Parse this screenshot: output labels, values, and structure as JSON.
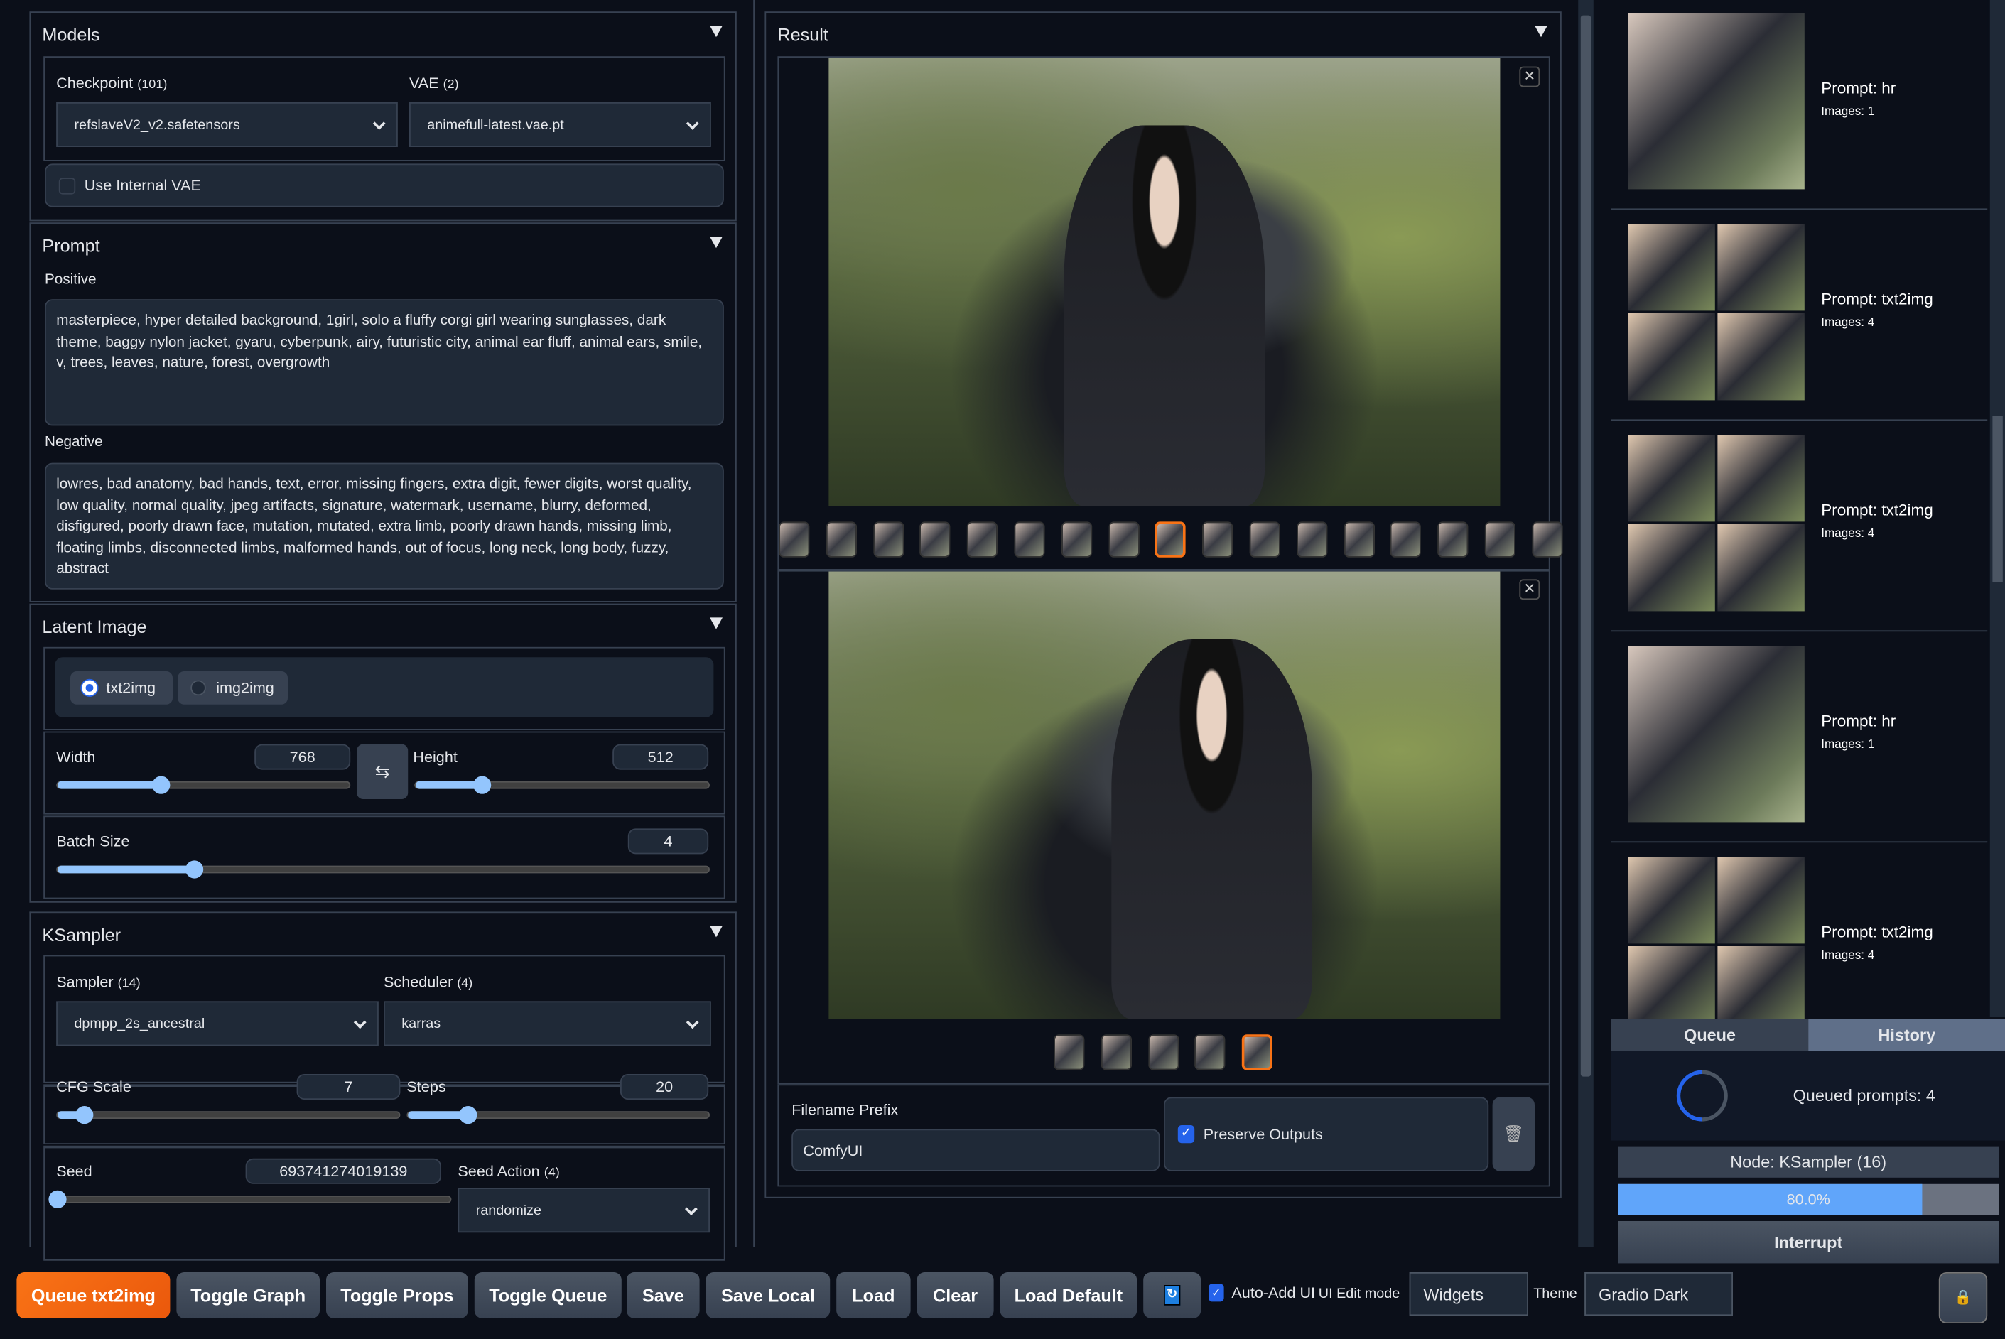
{
  "models": {
    "title": "Models",
    "checkpoint_label": "Checkpoint",
    "checkpoint_count": "(101)",
    "checkpoint_value": "refslaveV2_v2.safetensors",
    "vae_label": "VAE",
    "vae_count": "(2)",
    "vae_value": "animefull-latest.vae.pt",
    "use_internal_vae": "Use Internal VAE",
    "use_internal_vae_checked": false
  },
  "prompt": {
    "title": "Prompt",
    "positive_label": "Positive",
    "positive": "masterpiece, hyper detailed background, 1girl, solo a fluffy corgi girl wearing sunglasses, dark theme, baggy nylon jacket, gyaru, cyberpunk, airy, futuristic city, animal ear fluff, animal ears, smile, v, trees, leaves, nature, forest, overgrowth",
    "negative_label": "Negative",
    "negative": "lowres, bad anatomy, bad hands, text, error, missing fingers, extra digit, fewer digits, worst quality, low quality, normal quality, jpeg artifacts, signature, watermark, username, blurry, deformed, disfigured, poorly drawn face, mutation, mutated, extra limb, poorly drawn hands, missing limb, floating limbs, disconnected limbs, malformed hands, out of focus, long neck, long body, fuzzy, abstract"
  },
  "latent": {
    "title": "Latent Image",
    "mode_txt2img": "txt2img",
    "mode_img2img": "img2img",
    "selected_mode": "txt2img",
    "width_label": "Width",
    "width": "768",
    "width_fraction": 0.355,
    "height_label": "Height",
    "height": "512",
    "height_fraction": 0.226,
    "swap_icon": "swap-arrows-icon",
    "batch_label": "Batch Size",
    "batch": "4",
    "batch_fraction": 0.21
  },
  "ksampler": {
    "title": "KSampler",
    "sampler_label": "Sampler",
    "sampler_count": "(14)",
    "sampler_value": "dpmpp_2s_ancestral",
    "scheduler_label": "Scheduler",
    "scheduler_count": "(4)",
    "scheduler_value": "karras",
    "cfg_label": "CFG Scale",
    "cfg": "7",
    "cfg_fraction": 0.08,
    "steps_label": "Steps",
    "steps": "20",
    "steps_fraction": 0.2,
    "seed_label": "Seed",
    "seed": "693741274019139",
    "seed_fraction": 0.0,
    "seed_action_label": "Seed Action",
    "seed_action_count": "(4)",
    "seed_action_value": "randomize"
  },
  "result": {
    "title": "Result",
    "filename_prefix_label": "Filename Prefix",
    "filename_prefix": "ComfyUI",
    "preserve_outputs": "Preserve Outputs",
    "preserve_outputs_checked": true,
    "gallery1_selected": 9,
    "gallery1_count": 17,
    "gallery2_selected": 5,
    "gallery2_count": 5
  },
  "history": [
    {
      "prompt": "Prompt: hr",
      "images": "Images: 1"
    },
    {
      "prompt": "Prompt: txt2img",
      "images": "Images: 4"
    },
    {
      "prompt": "Prompt: txt2img",
      "images": "Images: 4"
    },
    {
      "prompt": "Prompt: hr",
      "images": "Images: 1"
    },
    {
      "prompt": "Prompt: txt2img",
      "images": "Images: 4"
    }
  ],
  "queue": {
    "tab_queue": "Queue",
    "tab_history": "History",
    "queued": "Queued prompts: 4",
    "node": "Node: KSampler (16)",
    "progress": "80.0%",
    "progress_value": 0.8,
    "interrupt": "Interrupt"
  },
  "toolbar": {
    "queue": "Queue txt2img",
    "toggle_graph": "Toggle Graph",
    "toggle_props": "Toggle Props",
    "toggle_queue": "Toggle Queue",
    "save": "Save",
    "save_local": "Save Local",
    "load": "Load",
    "clear": "Clear",
    "load_default": "Load Default",
    "auto_add": "Auto-Add UI",
    "auto_add_checked": true,
    "edit_mode_label": "UI Edit mode",
    "edit_mode": "Widgets",
    "theme_label": "Theme",
    "theme": "Gradio Dark",
    "accent": "#f97316"
  }
}
